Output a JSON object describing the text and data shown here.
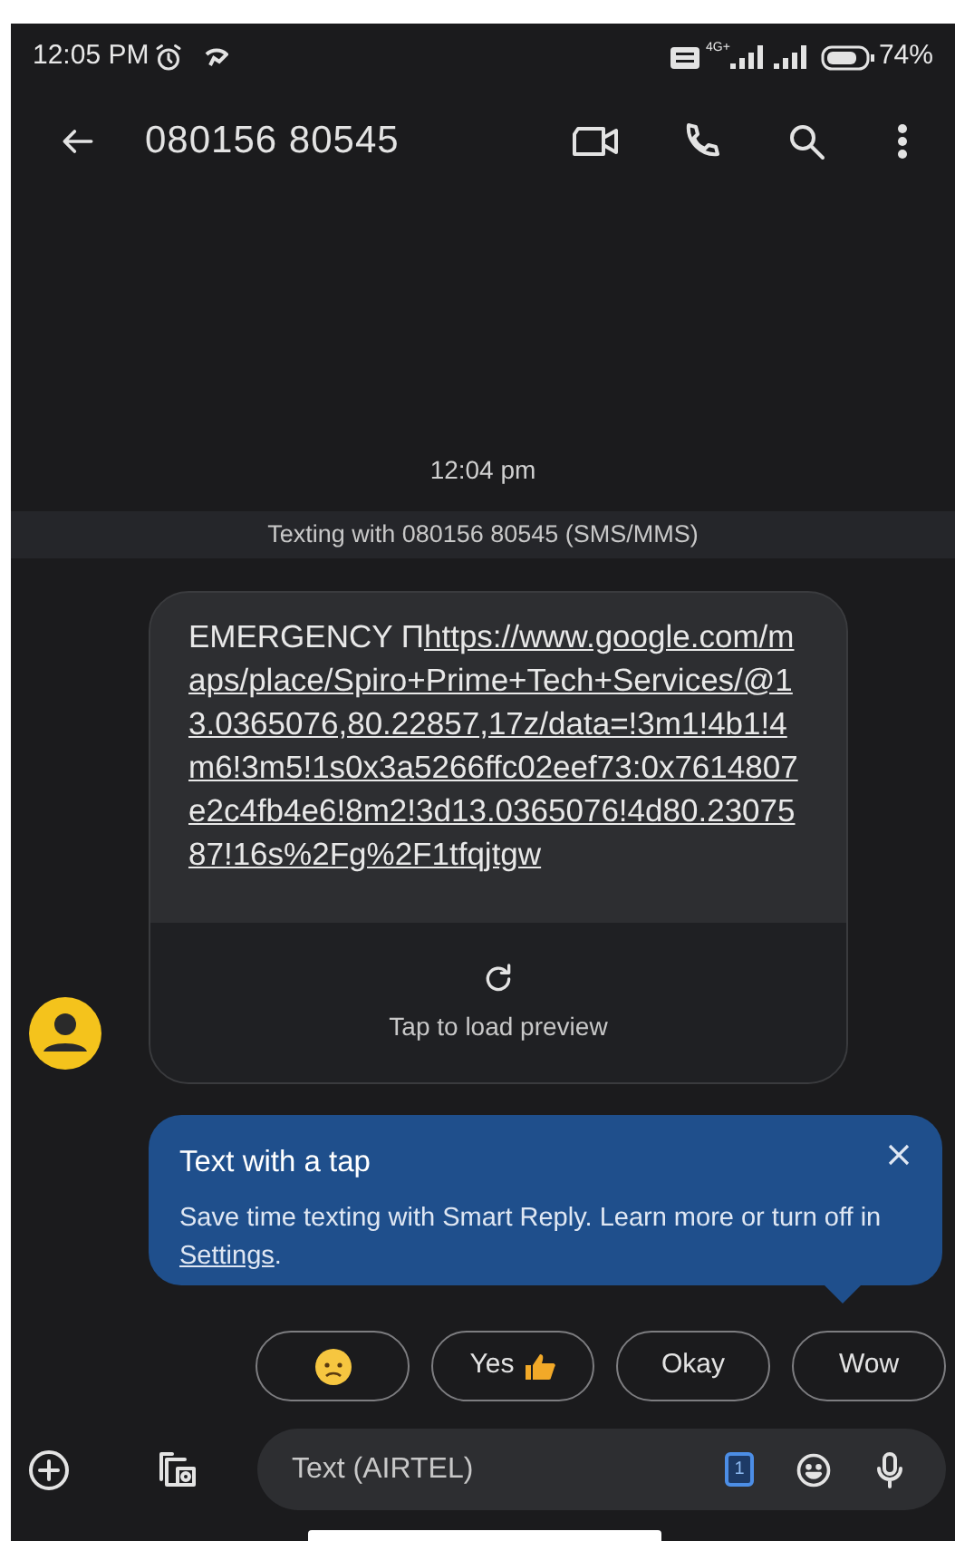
{
  "status_bar": {
    "time": "12:05 PM",
    "network": "4G+",
    "battery": "74%"
  },
  "header": {
    "title": "080156 80545"
  },
  "conversation": {
    "timestamp": "12:04 pm",
    "banner": "Texting with 080156 80545 (SMS/MMS)",
    "message": {
      "prefix": "EMERGENCY Π",
      "link": "https://www.google.com/maps/place/Spiro+Prime+Tech+Services/@13.0365076,80.22857,17z/data=!3m1!4b1!4m6!3m5!1s0x3a5266ffc02eef73:0x7614807e2c4fb4e6!8m2!3d13.0365076!4d80.2307587!16s%2Fg%2F1tfqjtgw",
      "preview": "Tap to load preview"
    }
  },
  "tooltip": {
    "title": "Text with a tap",
    "text_parts": [
      {
        "kind": "plain",
        "text": "Save time texting with Smart Reply. Learn more or turn off in "
      },
      {
        "kind": "link",
        "text": "Settings"
      },
      {
        "kind": "plain",
        "text": "."
      }
    ]
  },
  "smart_replies": [
    {
      "kind": "emoji"
    },
    {
      "kind": "thumb",
      "label": "Yes"
    },
    {
      "kind": "text",
      "label": "Okay"
    },
    {
      "kind": "text",
      "label": "Wow"
    }
  ],
  "composer": {
    "placeholder": "Text (AIRTEL)",
    "sim": "1"
  }
}
